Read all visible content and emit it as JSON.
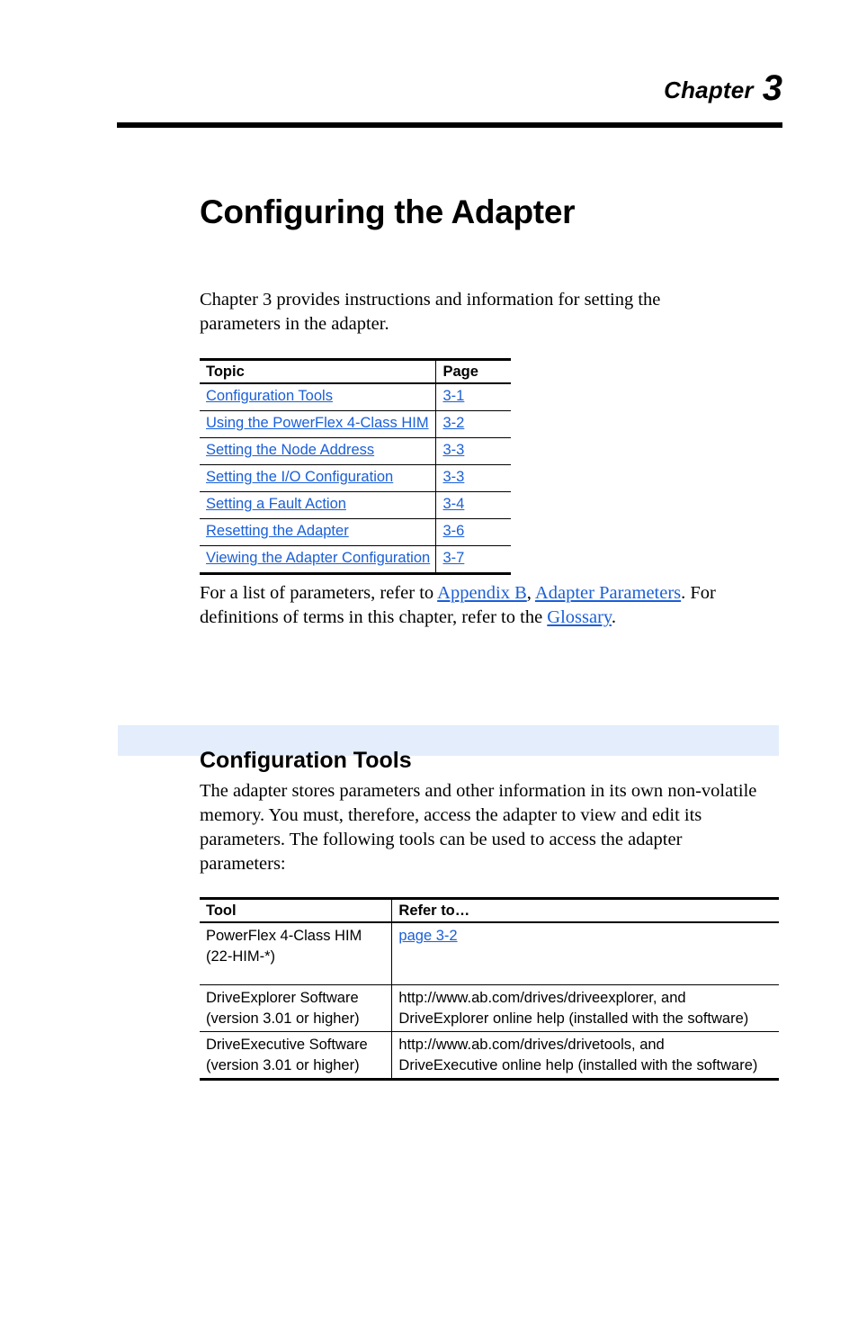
{
  "header": {
    "chapter_word": "Chapter",
    "chapter_number": "3"
  },
  "title": "Configuring the Adapter",
  "intro": {
    "line1": "Chapter 3 provides instructions and information for setting the",
    "line2": "parameters in the adapter."
  },
  "topics_table": {
    "headers": {
      "topic": "Topic",
      "page": "Page"
    },
    "rows": [
      {
        "topic": "Configuration Tools",
        "page": "3-1"
      },
      {
        "topic": "Using the PowerFlex 4-Class HIM",
        "page": "3-2"
      },
      {
        "topic": "Setting the Node Address",
        "page": "3-3"
      },
      {
        "topic": "Setting the I/O Configuration",
        "page": "3-3"
      },
      {
        "topic": "Setting a Fault Action",
        "page": "3-4"
      },
      {
        "topic": "Resetting the Adapter",
        "page": "3-6"
      },
      {
        "topic": "Viewing the Adapter Configuration",
        "page": "3-7"
      }
    ]
  },
  "after_table_para": {
    "t1": "For a list of parameters, refer to ",
    "link1": "Appendix B",
    "t2": ", ",
    "link2": "Adapter Parameters",
    "t3": ". For definitions of terms in this chapter, refer to the ",
    "link3": "Glossary",
    "t4": "."
  },
  "section": {
    "title": "Configuration Tools",
    "band_color": "#e3edfc"
  },
  "tools_para": {
    "line1": "The adapter stores parameters and other information in its own",
    "line2": "non-volatile memory. You must, therefore, access the adapter to view",
    "line3": "and edit its parameters. The following tools can be used to access the",
    "line4": "adapter parameters:"
  },
  "tools_table": {
    "headers": {
      "tool": "Tool",
      "refer": "Refer to…"
    },
    "rows": [
      {
        "tool_line1": "PowerFlex 4-Class HIM",
        "tool_line2": "(22-HIM-*)",
        "refer_link": "page 3-2",
        "refer_line1": "",
        "refer_line2": ""
      },
      {
        "tool_line1": "DriveExplorer Software",
        "tool_line2": "(version 3.01 or higher)",
        "refer_link": "",
        "refer_line1": "http://www.ab.com/drives/driveexplorer, and",
        "refer_line2": "DriveExplorer online help (installed with the software)"
      },
      {
        "tool_line1": "DriveExecutive Software",
        "tool_line2": "(version 3.01 or higher)",
        "refer_link": "",
        "refer_line1": "http://www.ab.com/drives/drivetools, and",
        "refer_line2": "DriveExecutive online help (installed with the software)"
      }
    ]
  },
  "colors": {
    "link": "#1a5fd7",
    "text": "#000000",
    "band": "#e3edfc"
  }
}
